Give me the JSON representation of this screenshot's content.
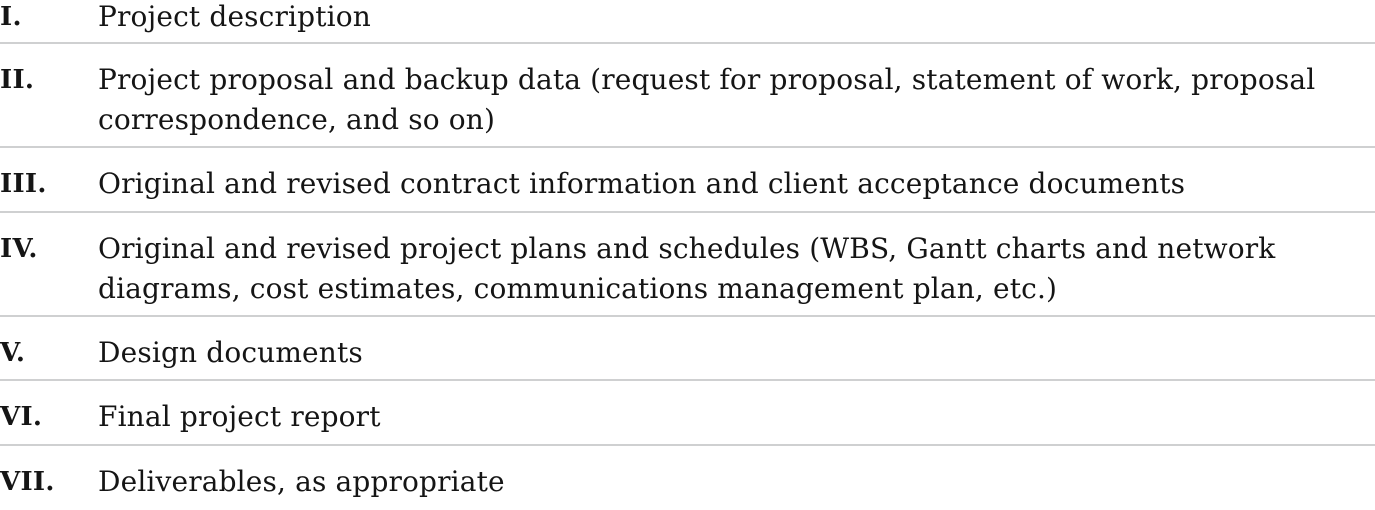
{
  "rows": [
    {
      "numeral": "I.",
      "text": "Project description"
    },
    {
      "numeral": "II.",
      "text": "Project proposal and backup data (request for proposal, statement of work, proposal correspondence, and so on)"
    },
    {
      "numeral": "III.",
      "text": "Original and revised contract information and client acceptance documents"
    },
    {
      "numeral": "IV.",
      "text": "Original and revised project plans and schedules (WBS, Gantt charts and network diagrams, cost estimates, communications management plan, etc.)"
    },
    {
      "numeral": "V.",
      "text": "Design documents"
    },
    {
      "numeral": "VI.",
      "text": "Final project report"
    },
    {
      "numeral": "VII.",
      "text": "Deliverables, as appropriate"
    }
  ]
}
